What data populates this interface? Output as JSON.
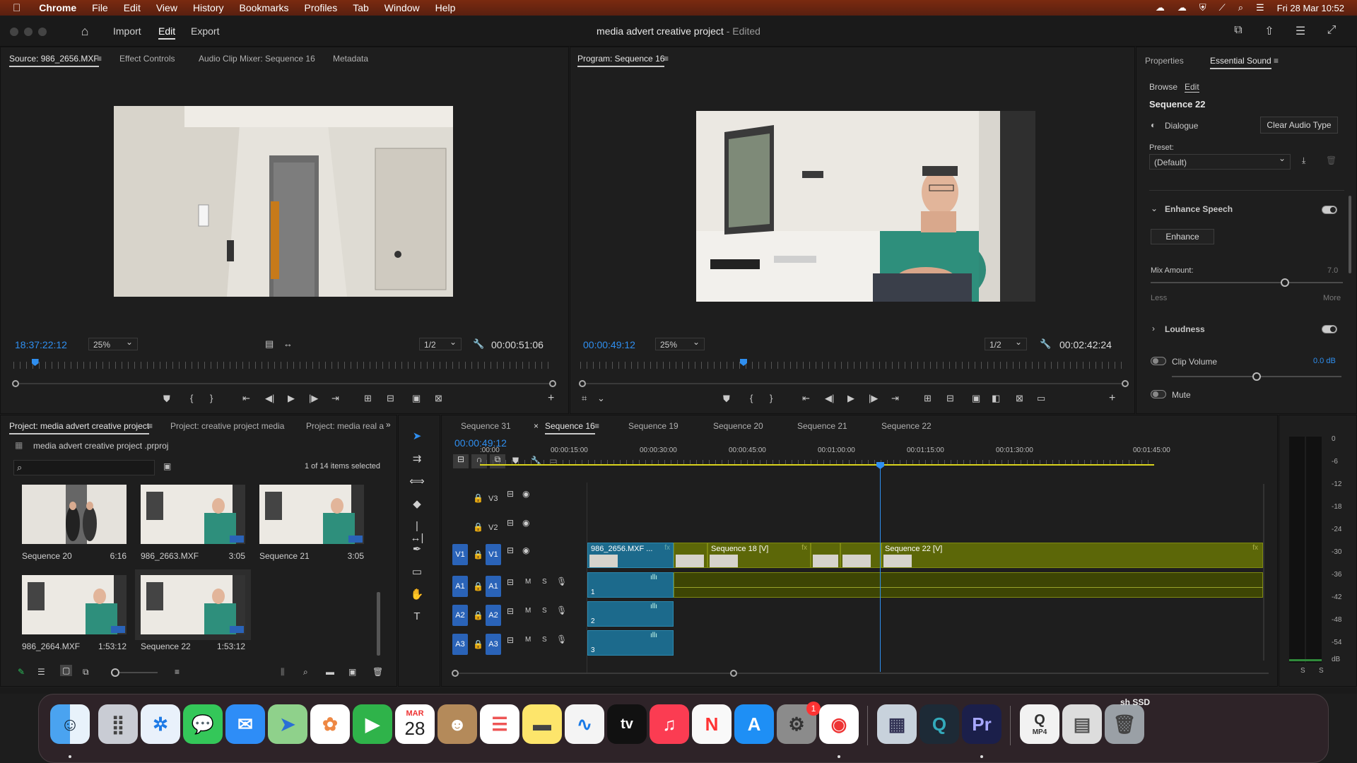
{
  "menubar": {
    "apple_icon": "apple-icon",
    "items": [
      "Chrome",
      "File",
      "Edit",
      "View",
      "History",
      "Bookmarks",
      "Profiles",
      "Tab",
      "Window",
      "Help"
    ],
    "datetime": "Fri 28 Mar  10:52"
  },
  "header": {
    "tabs": [
      "Import",
      "Edit",
      "Export"
    ],
    "active_tab": "Edit",
    "project_title": "media advert creative project",
    "edited_suffix": "- Edited"
  },
  "source_monitor": {
    "tabs": [
      "Source: 986_2656.MXF",
      "Effect Controls",
      "Audio Clip Mixer: Sequence 16",
      "Metadata"
    ],
    "timecode": "18:37:22:12",
    "zoom": "25%",
    "resolution": "1/2",
    "duration": "00:00:51:06",
    "playhead_fraction": 0.04
  },
  "program_monitor": {
    "tab": "Program: Sequence 16",
    "timecode": "00:00:49:12",
    "zoom": "25%",
    "resolution": "1/2",
    "duration": "00:02:42:24",
    "playhead_fraction": 0.3
  },
  "essential_sound": {
    "tabs": [
      "Properties",
      "Essential Sound"
    ],
    "subtabs": [
      "Browse",
      "Edit"
    ],
    "sequence_name": "Sequence 22",
    "type_label": "Dialogue",
    "clear_button": "Clear Audio Type",
    "preset_label": "Preset:",
    "preset_value": "(Default)",
    "enhance_speech_label": "Enhance Speech",
    "enhance_speech_on": true,
    "enhance_button": "Enhance",
    "mix_amount_label": "Mix Amount:",
    "mix_amount_value": "7.0",
    "mix_amount_fraction": 0.7,
    "mix_less": "Less",
    "mix_more": "More",
    "loudness_label": "Loudness",
    "loudness_on": true,
    "clip_volume_label": "Clip Volume",
    "clip_volume_on": false,
    "clip_volume_value": "0.0 dB",
    "clip_volume_fraction": 0.5,
    "mute_label": "Mute",
    "mute_on": false
  },
  "project_panel": {
    "tabs": [
      "Project: media advert creative project",
      "Project: creative project media",
      "Project: media real adv"
    ],
    "project_file": "media advert creative project .prproj",
    "search_placeholder": "",
    "selection_status": "1 of 14 items selected",
    "items": [
      {
        "name": "Sequence 20",
        "duration": "6:16"
      },
      {
        "name": "986_2663.MXF",
        "duration": "3:05"
      },
      {
        "name": "Sequence 21",
        "duration": "3:05"
      },
      {
        "name": "986_2664.MXF",
        "duration": "1:53:12"
      },
      {
        "name": "Sequence 22",
        "duration": "1:53:12"
      }
    ]
  },
  "timeline": {
    "sequence_tabs": [
      "Sequence 31",
      "Sequence 16",
      "Sequence 19",
      "Sequence 20",
      "Sequence 21",
      "Sequence 22"
    ],
    "active_sequence": "Sequence 16",
    "timecode": "00:00:49:12",
    "ruler_labels": [
      ":00:00",
      "00:00:15:00",
      "00:00:30:00",
      "00:00:45:00",
      "00:01:00:00",
      "00:01:15:00",
      "00:01:30:00",
      "00:01:45:00"
    ],
    "video_tracks": [
      {
        "name": "V3"
      },
      {
        "name": "V2"
      },
      {
        "name": "V1",
        "target": "V1"
      }
    ],
    "audio_tracks": [
      {
        "name": "A1",
        "target": "A1",
        "m": "M",
        "s": "S"
      },
      {
        "name": "A2",
        "target": "A2",
        "m": "M",
        "s": "S"
      },
      {
        "name": "A3",
        "target": "A3",
        "m": "M",
        "s": "S"
      }
    ],
    "clips": {
      "v1_first": "986_2656.MXF ...",
      "v1_seq18": "Sequence 18 [V]",
      "v1_seq22": "Sequence 22 [V]",
      "fx": "fx",
      "a1_num": "1",
      "a2_num": "2",
      "a3_num": "3"
    }
  },
  "audio_meter": {
    "scale": [
      "0",
      "-6",
      "-12",
      "-18",
      "-24",
      "-30",
      "-36",
      "-42",
      "-48",
      "-54",
      "dB"
    ],
    "solo_labels": [
      "S",
      "S"
    ]
  },
  "dock": {
    "calendar_month": "MAR",
    "calendar_day": "28",
    "settings_badge": "1",
    "ssd_label": "sh SSD",
    "mp4_label": "MP4",
    "apps": [
      "finder",
      "launchpad",
      "safari",
      "messages",
      "mail",
      "maps",
      "photos",
      "facetime",
      "calendar",
      "contacts",
      "reminders",
      "notes",
      "freeform",
      "tv",
      "music",
      "news",
      "app-store",
      "system-settings",
      "chrome",
      "preview",
      "quicktime",
      "premiere-pro",
      "mp4-file",
      "folder",
      "trash"
    ]
  }
}
